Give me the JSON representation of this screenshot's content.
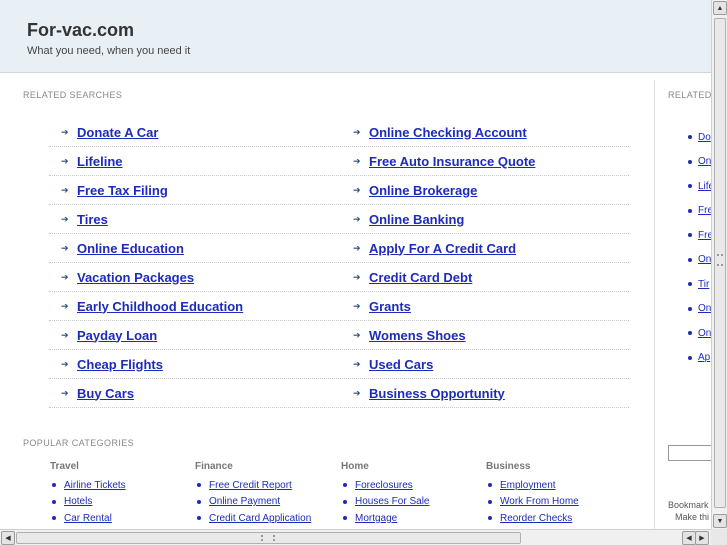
{
  "header": {
    "title": "For-vac.com",
    "tagline": "What you need, when you need it"
  },
  "related": {
    "title": "RELATED SEARCHES",
    "rows": [
      {
        "left": "Donate A Car",
        "right": "Online Checking Account"
      },
      {
        "left": "Lifeline",
        "right": "Free Auto Insurance Quote"
      },
      {
        "left": "Free Tax Filing",
        "right": "Online Brokerage"
      },
      {
        "left": "Tires",
        "right": "Online Banking"
      },
      {
        "left": "Online Education",
        "right": "Apply For A Credit Card"
      },
      {
        "left": "Vacation Packages",
        "right": "Credit Card Debt"
      },
      {
        "left": "Early Childhood Education",
        "right": "Grants"
      },
      {
        "left": "Payday Loan",
        "right": "Womens Shoes"
      },
      {
        "left": "Cheap Flights",
        "right": "Used Cars"
      },
      {
        "left": "Buy Cars",
        "right": "Business Opportunity"
      }
    ]
  },
  "popular": {
    "title": "POPULAR CATEGORIES",
    "columns": [
      {
        "heading": "Travel",
        "items": [
          "Airline Tickets",
          "Hotels",
          "Car Rental"
        ]
      },
      {
        "heading": "Finance",
        "items": [
          "Free Credit Report",
          "Online Payment",
          "Credit Card Application"
        ]
      },
      {
        "heading": "Home",
        "items": [
          "Foreclosures",
          "Houses For Sale",
          "Mortgage"
        ]
      },
      {
        "heading": "Business",
        "items": [
          "Employment",
          "Work From Home",
          "Reorder Checks"
        ]
      }
    ]
  },
  "side": {
    "title": "RELATED",
    "items": [
      "Do",
      "On",
      "Life",
      "Fre",
      "Fre",
      "On",
      "Tir",
      "On",
      "On",
      "Ap"
    ],
    "bookmark_line1": "Bookmark",
    "bookmark_line2": "Make thi"
  },
  "icons": {
    "arrow": "arrow-right-icon",
    "bullet": "bullet-icon"
  },
  "colors": {
    "link": "#1d2bbb",
    "header_bg": "#e8f0f6"
  }
}
